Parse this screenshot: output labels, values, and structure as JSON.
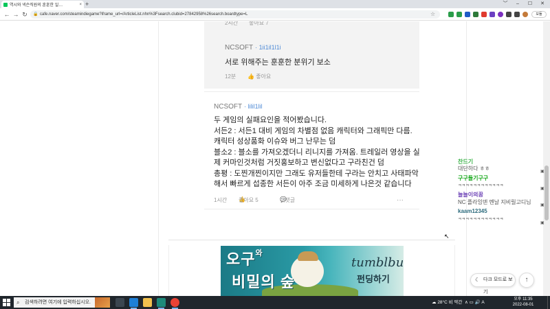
{
  "browser": {
    "tab_title": "역시와 넥슨직원의 훈훈한 일…",
    "tab_close": "×",
    "new_tab": "+",
    "url": "cafe.naver.com/steamindiegame?iframe_url=/ArticleList.nhn%3Fsearch.clubid=27842958%26search.boardtype=L",
    "profile_label": "모듈",
    "window_controls": [
      "﹀",
      "–",
      "☐",
      "✕"
    ]
  },
  "reply_prev": {
    "time": "2시간",
    "like": "좋아요 7"
  },
  "reply": {
    "author": "NCSOFT",
    "author_id": "1ii1il1l1i",
    "text": "서로 위해주는 훈훈한 분위기 보소",
    "time": "12분",
    "like": "좋아요"
  },
  "comment": {
    "author": "NCSOFT",
    "author_id": "lilil1lil",
    "lines": [
      "두 게임의 실패요인을 적어봤습니다.",
      "서든2 : 서든1 대비 게임의 차별점 없음 캐릭터와 그래픽만 다름.",
      "캐릭터 성상품화 이슈와 버그 난무는 덤",
      "블소2 : 블소를 가져오겠더니 리니지를 가져옴. 트레일러 영상을 실",
      "제 커마인것처럼 거짓홍보하고 변신없다고 구라친건 덤",
      "총평 : 도찐개찐이지만 그래도 유저들한테 구라는 안치고 사태파악",
      "해서 빠르게 섭종한 서든이 아주 조금 미세하게 나은것 같습니다"
    ],
    "time": "1시간",
    "like": "좋아요 5",
    "reply": "대댓글",
    "more": "···"
  },
  "banner": {
    "title_a": "오구",
    "title_small": "와",
    "title_b": "비밀의 숲",
    "brand": "tumblbug",
    "cta": "펀딩하기"
  },
  "chat": [
    {
      "user": "찬드기",
      "msg": "대단하다 ㅎㅎ",
      "color": "#3db34a"
    },
    {
      "user": "구구들기구구",
      "msg": "ㅋㅋㅋㅋㅋㅋㅋㅋㅋㅋㅋㅋ",
      "color": "#16a81a"
    },
    {
      "user": "늘늘이의꿈",
      "msg": "NC 플라잉덴 멘날 지비릴고디님",
      "color": "#6a3fb5"
    },
    {
      "user": "kaam12345",
      "msg": "ㅋㅋㅋㅋㅋㅋㅋㅋㅋㅋㅋㅋ",
      "color": "#2b6a7c"
    }
  ],
  "floating": {
    "dark_mode": "다크 모드로 보기",
    "to_top": "↑"
  },
  "taskbar": {
    "search_placeholder": "검색하려면 여기에 입력하십시오.",
    "weather": "28°C 비 약간",
    "tray_icons": "∧ ▭ 🔊 A",
    "time": "오후 11:35",
    "date": "2022-08-01"
  },
  "colors": {
    "author_id": "#4e8ad6",
    "naver_green": "#03c75a",
    "taskbar": "#20262c"
  }
}
